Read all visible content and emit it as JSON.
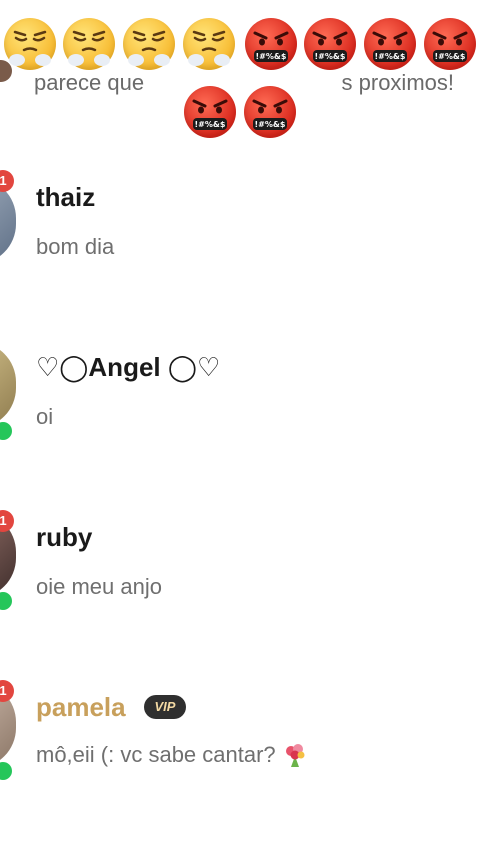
{
  "top_partial": {
    "left_fragment": "parece que",
    "right_fragment": "s proximos!"
  },
  "emoji_overlay": {
    "row1": [
      "huffing-face",
      "huffing-face",
      "huffing-face",
      "huffing-face",
      "cursing-face",
      "cursing-face",
      "cursing-face",
      "cursing-face"
    ],
    "row2": [
      "cursing-face",
      "cursing-face"
    ],
    "cursing_glyph_text": "!#%&$"
  },
  "chats": [
    {
      "name": "thaiz",
      "preview": "bom dia",
      "unread": "1",
      "online": false
    },
    {
      "name": "♡◯Angel ◯♡",
      "preview": "oi",
      "unread": "",
      "online": true
    },
    {
      "name": "ruby",
      "preview": "oie meu anjo",
      "unread": "1",
      "online": true
    },
    {
      "name": "pamela",
      "vip_label": "VIP",
      "preview": "mô,eii (: vc sabe cantar?",
      "unread": "1",
      "online": true
    }
  ],
  "colors": {
    "unread_badge": "#e2463f",
    "online_dot": "#25c65a",
    "vip_name": "#c8a05c"
  }
}
